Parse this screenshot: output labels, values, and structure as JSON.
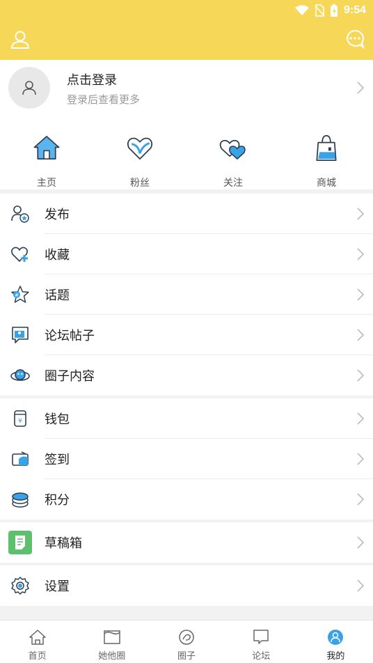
{
  "status_bar": {
    "time": "9:54",
    "icons": [
      "wifi-icon",
      "no-sim-icon",
      "battery-charging-icon"
    ]
  },
  "header": {
    "left_icon": "user-icon",
    "right_icon": "chat-bubble-icon"
  },
  "profile": {
    "title": "点击登录",
    "subtitle": "登录后查看更多"
  },
  "quick_actions": [
    {
      "label": "主页",
      "icon": "home-icon"
    },
    {
      "label": "粉丝",
      "icon": "heart-icon"
    },
    {
      "label": "关注",
      "icon": "double-heart-icon"
    },
    {
      "label": "商城",
      "icon": "shopping-bag-icon"
    }
  ],
  "menu_group_1": [
    {
      "label": "发布",
      "icon": "publish-icon"
    },
    {
      "label": "收藏",
      "icon": "favorite-icon"
    },
    {
      "label": "话题",
      "icon": "topic-icon"
    },
    {
      "label": "论坛帖子",
      "icon": "forum-post-icon"
    },
    {
      "label": "圈子内容",
      "icon": "circle-content-icon"
    }
  ],
  "menu_group_2": [
    {
      "label": "钱包",
      "icon": "wallet-icon"
    },
    {
      "label": "签到",
      "icon": "sign-in-icon"
    },
    {
      "label": "积分",
      "icon": "points-icon"
    }
  ],
  "menu_group_3": [
    {
      "label": "草稿箱",
      "icon": "drafts-icon"
    }
  ],
  "menu_group_4": [
    {
      "label": "设置",
      "icon": "settings-icon"
    }
  ],
  "tabbar": [
    {
      "label": "首页",
      "icon": "home-tab-icon",
      "active": false
    },
    {
      "label": "她他圈",
      "icon": "square-tab-icon",
      "active": false
    },
    {
      "label": "圈子",
      "icon": "circle-tab-icon",
      "active": false
    },
    {
      "label": "论坛",
      "icon": "forum-tab-icon",
      "active": false
    },
    {
      "label": "我的",
      "icon": "me-tab-icon",
      "active": true
    }
  ],
  "colors": {
    "header": "#f7d758",
    "accent_blue": "#3aa3e8",
    "draft_green": "#5cc06c"
  }
}
